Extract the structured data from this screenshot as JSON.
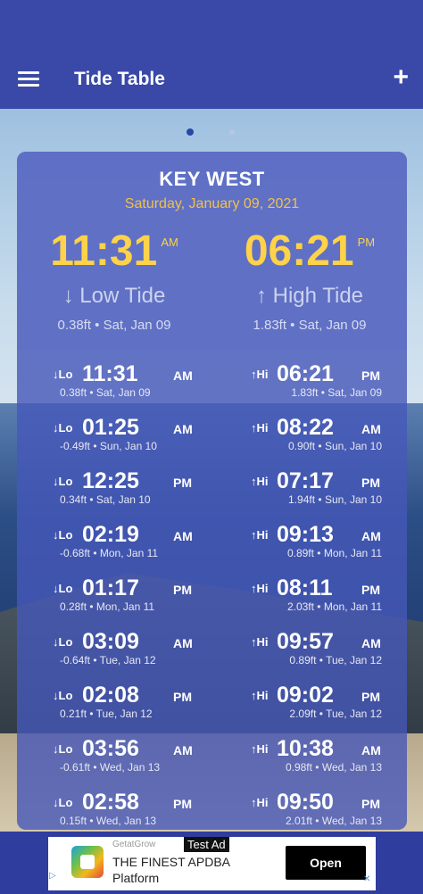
{
  "app": {
    "title": "Tide Table"
  },
  "pager": {
    "pages": 2,
    "active": 1
  },
  "summary": {
    "location": "KEY WEST",
    "date": "Saturday, January 09, 2021",
    "low": {
      "time": "11:31",
      "ampm": "AM",
      "kind": "↓ Low Tide",
      "detail": "0.38ft • Sat, Jan 09"
    },
    "high": {
      "time": "06:21",
      "ampm": "PM",
      "kind": "↑ High Tide",
      "detail": "1.83ft • Sat, Jan 09"
    }
  },
  "rows": [
    {
      "lo": {
        "tag": "↓Lo",
        "time": "11:31",
        "ampm": "AM",
        "sub": "0.38ft • Sat, Jan 09"
      },
      "hi": {
        "tag": "↑Hi",
        "time": "06:21",
        "ampm": "PM",
        "sub": "1.83ft • Sat, Jan 09"
      }
    },
    {
      "lo": {
        "tag": "↓Lo",
        "time": "01:25",
        "ampm": "AM",
        "sub": "-0.49ft • Sun, Jan 10"
      },
      "hi": {
        "tag": "↑Hi",
        "time": "08:22",
        "ampm": "AM",
        "sub": "0.90ft • Sun, Jan 10"
      }
    },
    {
      "lo": {
        "tag": "↓Lo",
        "time": "12:25",
        "ampm": "PM",
        "sub": "0.34ft • Sat, Jan 10"
      },
      "hi": {
        "tag": "↑Hi",
        "time": "07:17",
        "ampm": "PM",
        "sub": "1.94ft • Sun, Jan 10"
      }
    },
    {
      "lo": {
        "tag": "↓Lo",
        "time": "02:19",
        "ampm": "AM",
        "sub": "-0.68ft • Mon, Jan 11"
      },
      "hi": {
        "tag": "↑Hi",
        "time": "09:13",
        "ampm": "AM",
        "sub": "0.89ft • Mon, Jan 11"
      }
    },
    {
      "lo": {
        "tag": "↓Lo",
        "time": "01:17",
        "ampm": "PM",
        "sub": "0.28ft • Mon, Jan 11"
      },
      "hi": {
        "tag": "↑Hi",
        "time": "08:11",
        "ampm": "PM",
        "sub": "2.03ft • Mon, Jan 11"
      }
    },
    {
      "lo": {
        "tag": "↓Lo",
        "time": "03:09",
        "ampm": "AM",
        "sub": "-0.64ft • Tue, Jan 12"
      },
      "hi": {
        "tag": "↑Hi",
        "time": "09:57",
        "ampm": "AM",
        "sub": "0.89ft • Tue, Jan 12"
      }
    },
    {
      "lo": {
        "tag": "↓Lo",
        "time": "02:08",
        "ampm": "PM",
        "sub": "0.21ft • Tue, Jan 12"
      },
      "hi": {
        "tag": "↑Hi",
        "time": "09:02",
        "ampm": "PM",
        "sub": "2.09ft • Tue, Jan 12"
      }
    },
    {
      "lo": {
        "tag": "↓Lo",
        "time": "03:56",
        "ampm": "AM",
        "sub": "-0.61ft • Wed, Jan 13"
      },
      "hi": {
        "tag": "↑Hi",
        "time": "10:38",
        "ampm": "AM",
        "sub": "0.98ft • Wed, Jan 13"
      }
    },
    {
      "lo": {
        "tag": "↓Lo",
        "time": "02:58",
        "ampm": "PM",
        "sub": "0.15ft • Wed, Jan 13"
      },
      "hi": {
        "tag": "↑Hi",
        "time": "09:50",
        "ampm": "PM",
        "sub": "2.01ft • Wed, Jan 13"
      }
    }
  ],
  "ad": {
    "brand": "GetatGrow",
    "label": "Test Ad",
    "headline": "THE FINEST APDBA",
    "headline2": "Platform",
    "button": "Open"
  },
  "icons": {
    "menu": "menu-icon",
    "add": "add-icon",
    "ad_info": "info-icon",
    "ad_close": "close-icon"
  },
  "colors": {
    "appbar": "#3a49a8",
    "accent": "#ffd249",
    "date": "#f1c14a"
  }
}
